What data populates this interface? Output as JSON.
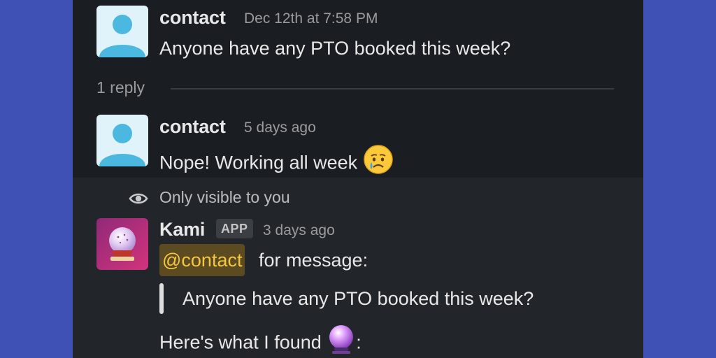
{
  "messages": [
    {
      "author": "contact",
      "timestamp": "Dec 12th at 7:58 PM",
      "text": "Anyone have any PTO booked this week?"
    },
    {
      "author": "contact",
      "timestamp": "5 days ago",
      "text": "Nope! Working all week",
      "emoji": "crying-face"
    }
  ],
  "thread": {
    "reply_count": "1 reply"
  },
  "ephemeral": {
    "visibility_note": "Only visible to you",
    "author": "Kami",
    "badge": "APP",
    "timestamp": "3 days ago",
    "mention": "@contact",
    "mention_suffix": "for message:",
    "quote": "Anyone have any PTO booked this week?",
    "found_text": "Here's what I found",
    "found_suffix": ":",
    "found_emoji": "crystal-ball"
  },
  "colors": {
    "page_background": "#3f51b5",
    "panel_background": "#1a1d21",
    "ephemeral_background": "#222529",
    "mention_text": "#f2c744",
    "mention_background": "#5c4a20",
    "avatar_background": "#e0f3fb",
    "avatar_figure": "#4bb8e0"
  }
}
